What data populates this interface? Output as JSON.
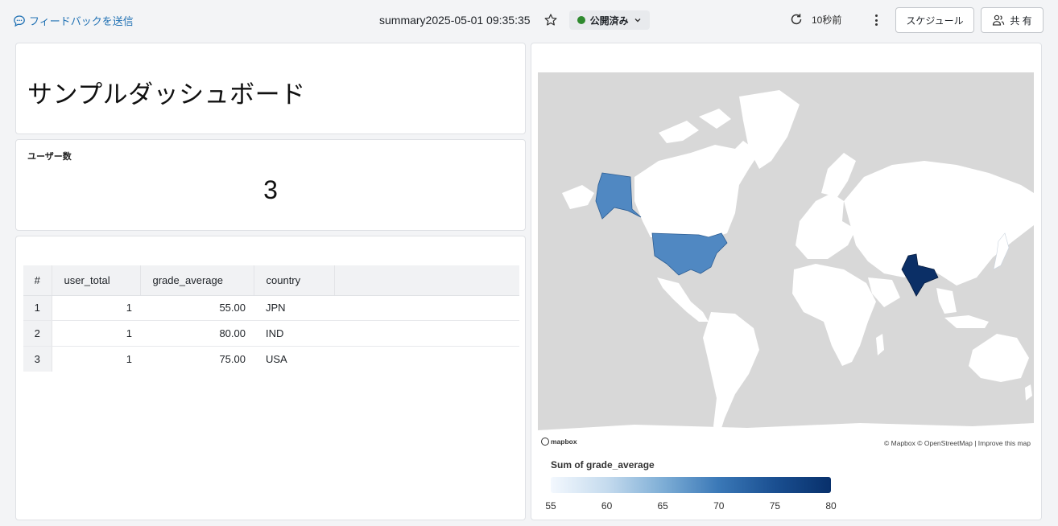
{
  "header": {
    "feedback_label": "フィードバックを送信",
    "dashboard_title": "summary2025-05-01 09:35:35",
    "status_label": "公開済み",
    "refresh_label": "10秒前",
    "schedule_button": "スケジュール",
    "share_button": "共 有"
  },
  "title_widget": {
    "text": "サンプルダッシュボード"
  },
  "counter_widget": {
    "label": "ユーザー数",
    "value": "3"
  },
  "table_widget": {
    "columns": [
      "#",
      "user_total",
      "grade_average",
      "country"
    ],
    "rows": [
      {
        "idx": "1",
        "user_total": "1",
        "grade_average": "55.00",
        "country": "JPN"
      },
      {
        "idx": "2",
        "user_total": "1",
        "grade_average": "80.00",
        "country": "IND"
      },
      {
        "idx": "3",
        "user_total": "1",
        "grade_average": "75.00",
        "country": "USA"
      }
    ]
  },
  "map_widget": {
    "attribution": "© Mapbox © OpenStreetMap | Improve this map",
    "logo_text": "mapbox",
    "legend_title": "Sum of grade_average",
    "legend_ticks": [
      "55",
      "60",
      "65",
      "70",
      "75",
      "80"
    ],
    "colors": {
      "USA": "#5088c2",
      "IND": "#0b2f66",
      "JPN": "#ffffff",
      "land": "#ffffff",
      "water": "#d8d8d8"
    }
  },
  "chart_data": {
    "type": "choropleth",
    "metric": "Sum of grade_average",
    "regions": [
      {
        "country": "JPN",
        "value": 55
      },
      {
        "country": "IND",
        "value": 80
      },
      {
        "country": "USA",
        "value": 75
      }
    ],
    "scale_range": [
      55,
      80
    ],
    "scale_ticks": [
      55,
      60,
      65,
      70,
      75,
      80
    ]
  }
}
